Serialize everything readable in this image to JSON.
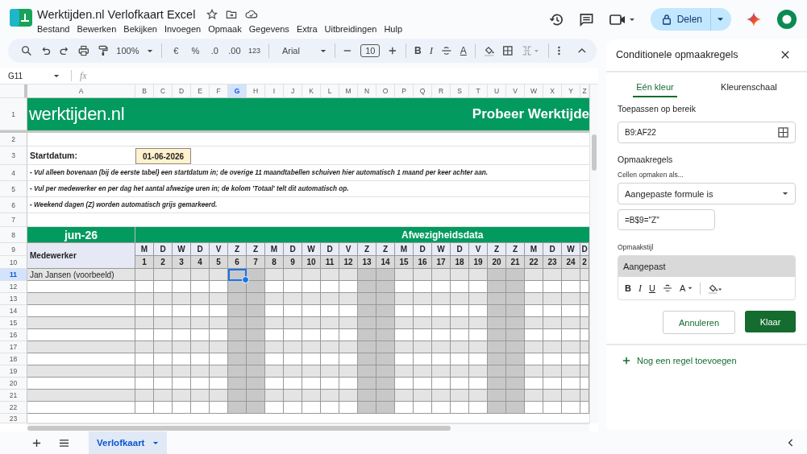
{
  "document": {
    "title": "Werktijden.nl Verlofkaart Excel"
  },
  "menu": [
    "Bestand",
    "Bewerken",
    "Bekijken",
    "Invoegen",
    "Opmaak",
    "Gegevens",
    "Extra",
    "Uitbreidingen",
    "Hulp"
  ],
  "share_button": {
    "label": "Delen"
  },
  "toolbar": {
    "zoom": "100%",
    "number_formats": [
      "€",
      "%",
      ".0",
      ".00",
      "123"
    ],
    "font": "Arial",
    "font_size": "10",
    "bold": "B",
    "italic": "I",
    "text_color": "A"
  },
  "formula_bar": {
    "cell_reference": "G11",
    "function_label": "fx"
  },
  "sheet": {
    "columns": [
      {
        "label": "A",
        "selected": false
      },
      {
        "label": "B",
        "selected": false
      },
      {
        "label": "C",
        "selected": false
      },
      {
        "label": "D",
        "selected": false
      },
      {
        "label": "E",
        "selected": false
      },
      {
        "label": "F",
        "selected": false
      },
      {
        "label": "G",
        "selected": true
      },
      {
        "label": "H",
        "selected": false
      },
      {
        "label": "I",
        "selected": false
      },
      {
        "label": "J",
        "selected": false
      },
      {
        "label": "K",
        "selected": false
      },
      {
        "label": "L",
        "selected": false
      },
      {
        "label": "M",
        "selected": false
      },
      {
        "label": "N",
        "selected": false
      },
      {
        "label": "O",
        "selected": false
      },
      {
        "label": "P",
        "selected": false
      },
      {
        "label": "Q",
        "selected": false
      },
      {
        "label": "R",
        "selected": false
      },
      {
        "label": "S",
        "selected": false
      },
      {
        "label": "T",
        "selected": false
      },
      {
        "label": "U",
        "selected": false
      },
      {
        "label": "V",
        "selected": false
      },
      {
        "label": "W",
        "selected": false
      },
      {
        "label": "X",
        "selected": false
      },
      {
        "label": "Y",
        "selected": false
      },
      {
        "label": "Z",
        "selected": false
      }
    ],
    "rows": [
      {
        "label": "1",
        "selected": false
      },
      {
        "label": "2",
        "selected": false
      },
      {
        "label": "3",
        "selected": false
      },
      {
        "label": "4",
        "selected": false
      },
      {
        "label": "5",
        "selected": false
      },
      {
        "label": "6",
        "selected": false
      },
      {
        "label": "7",
        "selected": false
      },
      {
        "label": "8",
        "selected": false
      },
      {
        "label": "9",
        "selected": false
      },
      {
        "label": "10",
        "selected": false
      },
      {
        "label": "11",
        "selected": true
      },
      {
        "label": "12",
        "selected": false
      },
      {
        "label": "13",
        "selected": false
      },
      {
        "label": "14",
        "selected": false
      },
      {
        "label": "15",
        "selected": false
      },
      {
        "label": "16",
        "selected": false
      },
      {
        "label": "17",
        "selected": false
      },
      {
        "label": "18",
        "selected": false
      },
      {
        "label": "19",
        "selected": false
      },
      {
        "label": "20",
        "selected": false
      },
      {
        "label": "21",
        "selected": false
      },
      {
        "label": "22",
        "selected": false
      },
      {
        "label": "23",
        "selected": false
      }
    ]
  },
  "banner": {
    "logo": "werktijden.nl",
    "promo": "Probeer Werktijde"
  },
  "start": {
    "label": "Startdatum:",
    "value": "01-06-2026"
  },
  "notes": [
    "- Vul alleen bovenaan (bij de eerste tabel) een startdatum in; de overige 11 maandtabellen schuiven hier automatisch 1 maand per keer achter aan.",
    "- Vul per medewerker en per dag het aantal afwezige uren in; de kolom 'Totaal' telt dit automatisch op.",
    "- Weekend dagen (Z) worden automatisch grijs gemarkeerd."
  ],
  "calendar": {
    "month": "jun-26",
    "title": "Afwezigheidsdata",
    "employee_header": "Medewerker",
    "days": [
      {
        "letter": "M",
        "number": "1",
        "weekend": false
      },
      {
        "letter": "D",
        "number": "2",
        "weekend": false
      },
      {
        "letter": "W",
        "number": "3",
        "weekend": false
      },
      {
        "letter": "D",
        "number": "4",
        "weekend": false
      },
      {
        "letter": "V",
        "number": "5",
        "weekend": false
      },
      {
        "letter": "Z",
        "number": "6",
        "weekend": true
      },
      {
        "letter": "Z",
        "number": "7",
        "weekend": true
      },
      {
        "letter": "M",
        "number": "8",
        "weekend": false
      },
      {
        "letter": "D",
        "number": "9",
        "weekend": false
      },
      {
        "letter": "W",
        "number": "10",
        "weekend": false
      },
      {
        "letter": "D",
        "number": "11",
        "weekend": false
      },
      {
        "letter": "V",
        "number": "12",
        "weekend": false
      },
      {
        "letter": "Z",
        "number": "13",
        "weekend": true
      },
      {
        "letter": "Z",
        "number": "14",
        "weekend": true
      },
      {
        "letter": "M",
        "number": "15",
        "weekend": false
      },
      {
        "letter": "D",
        "number": "16",
        "weekend": false
      },
      {
        "letter": "W",
        "number": "17",
        "weekend": false
      },
      {
        "letter": "D",
        "number": "18",
        "weekend": false
      },
      {
        "letter": "V",
        "number": "19",
        "weekend": false
      },
      {
        "letter": "Z",
        "number": "20",
        "weekend": true
      },
      {
        "letter": "Z",
        "number": "21",
        "weekend": true
      },
      {
        "letter": "M",
        "number": "22",
        "weekend": false
      },
      {
        "letter": "D",
        "number": "23",
        "weekend": false
      },
      {
        "letter": "W",
        "number": "24",
        "weekend": false
      },
      {
        "letter": "D",
        "number": "2",
        "weekend": false
      }
    ],
    "employees": [
      {
        "name": "Jan Jansen (voorbeeld)",
        "striped": true
      },
      {
        "striped": false
      },
      {
        "striped": true
      },
      {
        "striped": false
      },
      {
        "striped": true
      },
      {
        "striped": false
      },
      {
        "striped": true
      },
      {
        "striped": false
      },
      {
        "striped": true
      },
      {
        "striped": false
      },
      {
        "striped": true
      },
      {
        "striped": false
      }
    ]
  },
  "sheet_tabs": [
    {
      "label": "Verlofkaart",
      "selected": true
    }
  ],
  "panel": {
    "title": "Conditionele opmaakregels",
    "tabs": [
      {
        "label": "Eén kleur",
        "selected": true
      },
      {
        "label": "Kleurenschaal",
        "selected": false
      }
    ],
    "range_label": "Toepassen op bereik",
    "range": "B9:AF22",
    "rules_label": "Opmaakregels",
    "condition_label": "Cellen opmaken als...",
    "condition": "Aangepaste formule is",
    "formula": "=B$9=\"Z\"",
    "style_label": "Opmaakstijl",
    "style_preview": "Aangepast",
    "style_tools": {
      "bold": "B",
      "italic": "I",
      "underline": "U",
      "text_color": "A"
    },
    "cancel": "Annuleren",
    "done": "Klaar",
    "add_rule": "Nog een regel toevoegen"
  }
}
